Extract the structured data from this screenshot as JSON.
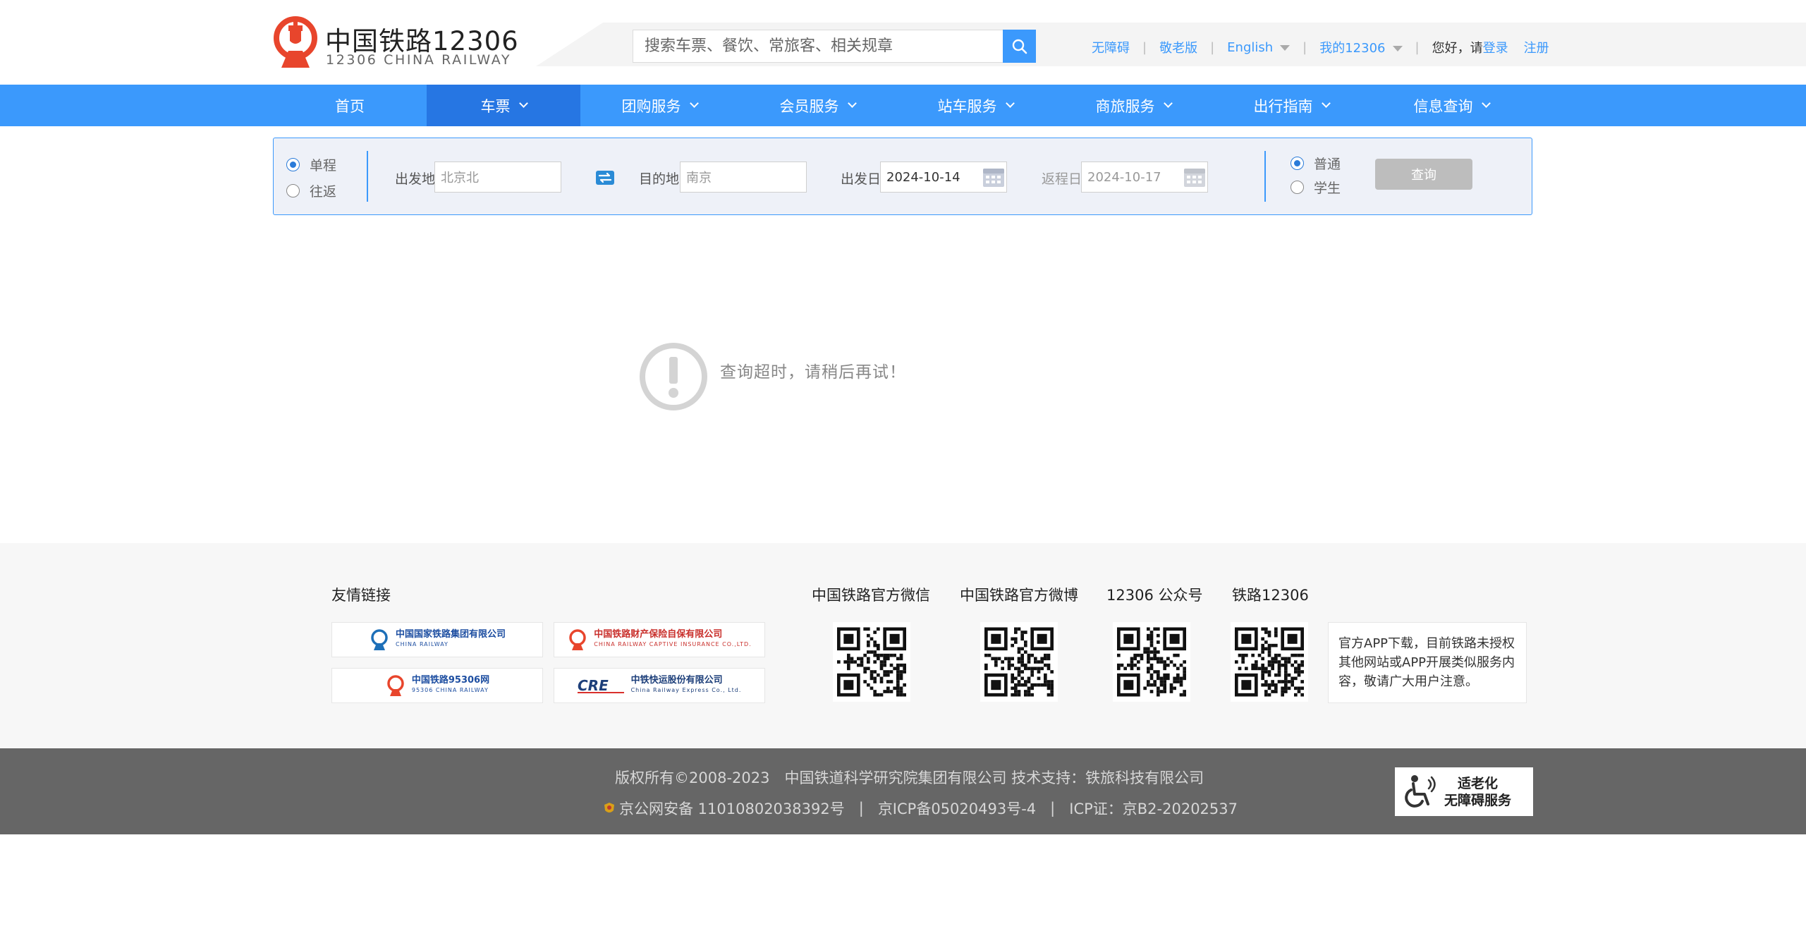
{
  "header": {
    "logo_cn": "中国铁路12306",
    "logo_en": "12306 CHINA RAILWAY",
    "search_placeholder": "搜索车票、餐饮、常旅客、相关规章",
    "links": {
      "accessible": "无障碍",
      "elder": "敬老版",
      "english": "English",
      "my12306": "我的12306",
      "greeting": "您好，请",
      "login": "登录",
      "register": "注册"
    },
    "link_color": "#3b99fc"
  },
  "nav": {
    "items": [
      "首页",
      "车票",
      "团购服务",
      "会员服务",
      "站车服务",
      "商旅服务",
      "出行指南",
      "信息查询"
    ],
    "active": "车票",
    "bg_color": "#3b99fc",
    "active_color": "#2676e3"
  },
  "query": {
    "trip_types": [
      "单程",
      "往返"
    ],
    "trip_selected": "单程",
    "from_label": "出发地",
    "from_value": "北京北",
    "to_label": "目的地",
    "to_value": "南京",
    "depart_label": "出发日",
    "depart_value": "2024-10-14",
    "return_label": "返程日",
    "return_value": "2024-10-17",
    "passenger_types": [
      "普通",
      "学生"
    ],
    "passenger_selected": "普通",
    "search_button": "查询"
  },
  "message": {
    "text": "查询超时，请稍后再试！",
    "icon": "exclamation-circle-icon"
  },
  "footer": {
    "friend_links_title": "友情链接",
    "partners": [
      {
        "name": "中国国家铁路集团有限公司",
        "sub": "CHINA RAILWAY",
        "icon": "railway-logo-icon"
      },
      {
        "name": "中国铁路财产保险自保有限公司",
        "sub": "CHINA RAILWAY CAPTIVE INSURANCE CO.,LTD.",
        "icon": "railway-logo-icon"
      },
      {
        "name": "中国铁路95306网",
        "sub": "95306 CHINA RAILWAY",
        "icon": "railway-logo-icon"
      },
      {
        "name": "中铁快运股份有限公司",
        "sub": "China Railway Express Co., Ltd.",
        "icon": "cre-logo-icon"
      }
    ],
    "qr_sections": [
      "中国铁路官方微信",
      "中国铁路官方微博",
      "12306 公众号",
      "铁路12306"
    ],
    "notice": "官方APP下载，目前铁路未授权其他网站或APP开展类似服务内容，敬请广大用户注意。"
  },
  "bottom": {
    "copyright": "版权所有©2008-2023　中国铁道科学研究院集团有限公司 技术支持：铁旅科技有限公司",
    "police_record": "京公网安备 11010802038392号",
    "icp_record": "京ICP备05020493号-4",
    "icp_license": "ICP证：京B2-20202537",
    "access_badge_line1": "适老化",
    "access_badge_line2": "无障碍服务"
  }
}
